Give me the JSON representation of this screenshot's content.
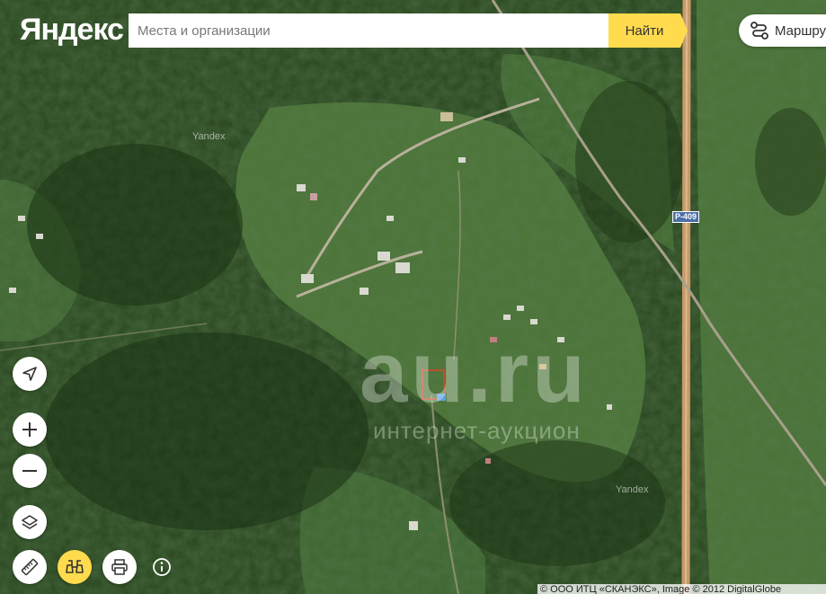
{
  "header": {
    "logo": "Яндекс",
    "search_placeholder": "Места и организации",
    "search_value": "",
    "find_label": "Найти",
    "route_label": "Маршруты"
  },
  "map": {
    "road_label": "Р-409",
    "provider_watermark": "Yandex",
    "watermark_main": "au.ru",
    "watermark_sub": "интернет-аукцион",
    "copyright": "© ООО ИТЦ «СКАНЭКС», Image © 2012 DigitalGlobe"
  },
  "controls": {
    "geolocation": "navigation-arrow",
    "zoom_in": "plus",
    "zoom_out": "minus",
    "layers": "layers",
    "ruler": "ruler",
    "panorama": "binoculars",
    "print": "printer",
    "info": "info"
  },
  "colors": {
    "accent": "#ffdb4d",
    "forest_dark": "#1f3a1a",
    "field_light": "#4f7a3a",
    "road": "#c89a6a",
    "road_badge": "#4a6fa5"
  }
}
